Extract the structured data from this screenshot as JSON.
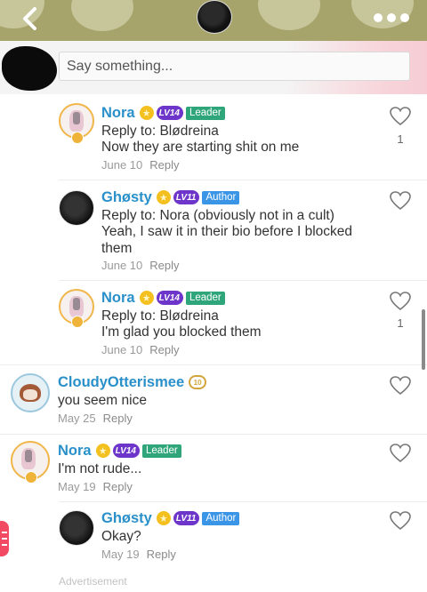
{
  "composer": {
    "placeholder": "Say something..."
  },
  "comments": [
    {
      "name": "Nora",
      "level": "LV14",
      "role": "Leader",
      "reply_to": "Reply to: Blødreina",
      "text": "Now they are starting shit on me",
      "date": "June 10",
      "reply": "Reply",
      "likes": "1"
    },
    {
      "name": "Ghøsty",
      "level": "LV11",
      "role": "Author",
      "reply_to": "Reply to: Nora (obviously not in a cult)",
      "text": "Yeah, I saw it in their bio before I blocked them",
      "date": "June 10",
      "reply": "Reply"
    },
    {
      "name": "Nora",
      "level": "LV14",
      "role": "Leader",
      "reply_to": "Reply to: Blødreina",
      "text": "I'm glad you blocked them",
      "date": "June 10",
      "reply": "Reply",
      "likes": "1"
    },
    {
      "name": "CloudyOtterismee",
      "level": "LV10",
      "text": "you seem nice",
      "date": "May 25",
      "reply": "Reply"
    },
    {
      "name": "Nora",
      "level": "LV14",
      "role": "Leader",
      "text": "I'm not rude...",
      "date": "May 19",
      "reply": "Reply"
    },
    {
      "name": "Ghøsty",
      "level": "LV11",
      "role": "Author",
      "text": "Okay?",
      "date": "May 19",
      "reply": "Reply"
    }
  ],
  "footer": {
    "advertisement": "Advertisement"
  },
  "colors": {
    "name": "#2a90c9",
    "leader": "#2fa67a",
    "author": "#3b95e6",
    "level": "#6d35c9",
    "accent": "#f24a62"
  },
  "icons": [
    "back-chevron-icon",
    "more-dots-icon",
    "heart-icon",
    "crown-icon",
    "level-badge-icon",
    "menu-tab-icon"
  ]
}
